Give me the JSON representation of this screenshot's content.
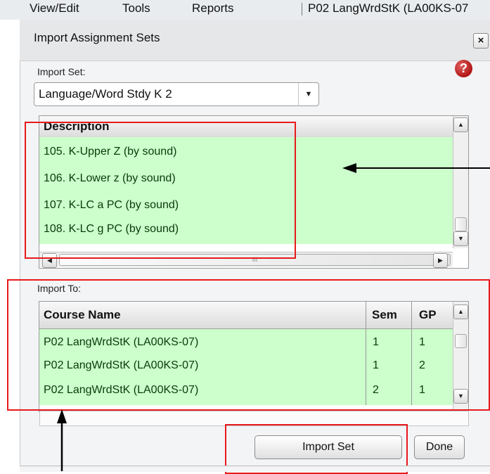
{
  "menu": {
    "items": [
      "View/Edit",
      "Tools",
      "Reports"
    ],
    "course_context": "P02  LangWrdStK (LA00KS-07"
  },
  "dialog": {
    "title": "Import Assignment Sets",
    "close_glyph": "×",
    "help_glyph": "?",
    "import_set_label": "Import Set:",
    "import_set_value": "Language/Word Stdy K 2",
    "description_header": "Description",
    "descriptions": [
      "105. K-Upper Z (by sound)",
      "106. K-Lower z (by sound)",
      "107. K-LC a PC (by sound)",
      "108. K-LC g PC (by sound)"
    ],
    "scroll_grip": "III",
    "import_to_label": "Import To:",
    "course_headers": {
      "name": "Course Name",
      "sem": "Sem",
      "gp": "GP"
    },
    "courses": [
      {
        "name": "P02  LangWrdStK (LA00KS-07)",
        "sem": "1",
        "gp": "1"
      },
      {
        "name": "P02  LangWrdStK (LA00KS-07)",
        "sem": "1",
        "gp": "2"
      },
      {
        "name": "P02  LangWrdStK (LA00KS-07)",
        "sem": "2",
        "gp": "1"
      }
    ],
    "import_button": "Import Set",
    "done_button": "Done"
  },
  "colors": {
    "row_green": "#ccffcc",
    "highlight_red": "#e8191c",
    "help_red": "#b01515"
  },
  "icons": [
    "close-icon",
    "help-icon",
    "dropdown-arrow-icon",
    "scroll-up-icon",
    "scroll-down-icon",
    "scroll-left-icon",
    "scroll-right-icon",
    "arrow-icon"
  ]
}
